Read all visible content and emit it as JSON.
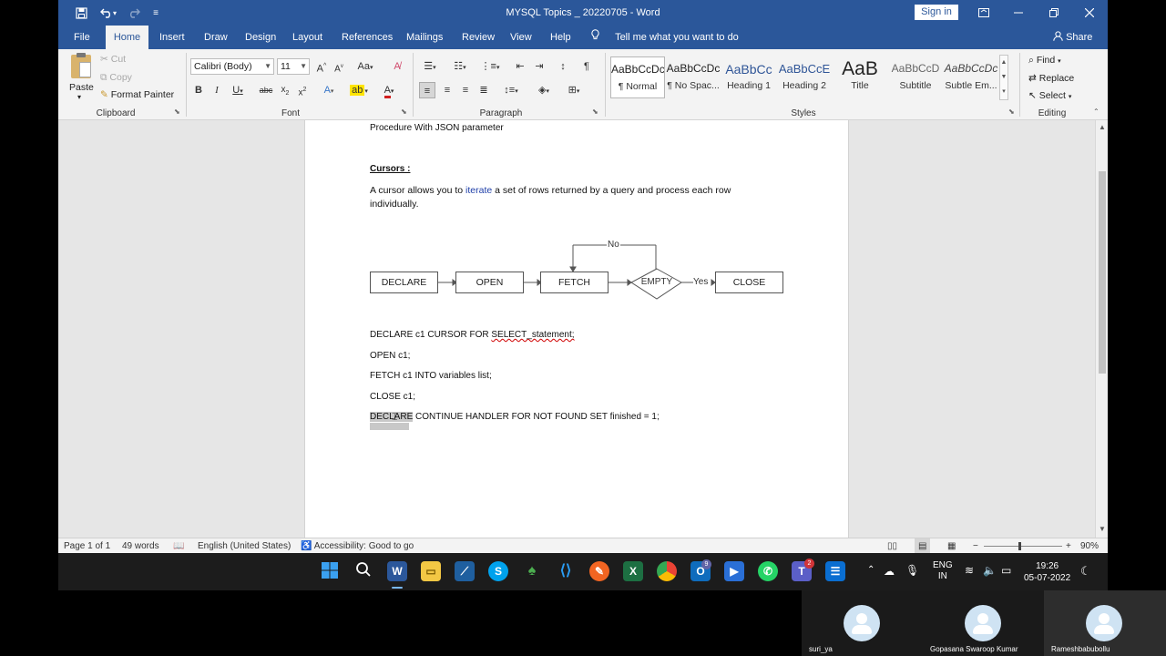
{
  "window": {
    "title": "MYSQL Topics  _  20220705  -  Word",
    "sign_in": "Sign in"
  },
  "tabs": [
    "File",
    "Home",
    "Insert",
    "Draw",
    "Design",
    "Layout",
    "References",
    "Mailings",
    "Review",
    "View",
    "Help"
  ],
  "active_tab": "Home",
  "tell_me": "Tell me what you want to do",
  "share": "Share",
  "clipboard": {
    "paste": "Paste",
    "cut": "Cut",
    "copy": "Copy",
    "format_painter": "Format Painter",
    "label": "Clipboard"
  },
  "font": {
    "name": "Calibri (Body)",
    "size": "11",
    "label": "Font"
  },
  "paragraph": {
    "label": "Paragraph"
  },
  "styles": {
    "label": "Styles",
    "items": [
      {
        "preview": "AaBbCcDc",
        "name": "¶ Normal"
      },
      {
        "preview": "AaBbCcDc",
        "name": "¶ No Spac..."
      },
      {
        "preview": "AaBbCc",
        "name": "Heading 1"
      },
      {
        "preview": "AaBbCcE",
        "name": "Heading 2"
      },
      {
        "preview": "AaB",
        "name": "Title"
      },
      {
        "preview": "AaBbCcD",
        "name": "Subtitle"
      },
      {
        "preview": "AaBbCcDc",
        "name": "Subtle Em..."
      }
    ]
  },
  "editing": {
    "find": "Find",
    "replace": "Replace",
    "select": "Select",
    "label": "Editing"
  },
  "document": {
    "line_procedure": "Procedure With JSON parameter",
    "cursors_heading": "Cursors :",
    "desc_part1": "A cursor allows you to ",
    "desc_link": "iterate",
    "desc_part2": " a set of rows returned by a query and process each row",
    "desc_line2": "individually.",
    "diagram": {
      "declare": "DECLARE",
      "open": "OPEN",
      "fetch": "FETCH",
      "empty": "EMPTY",
      "close": "CLOSE",
      "no": "No",
      "yes": "Yes"
    },
    "code_declare_a": "DECLARE c1 CURSOR FOR ",
    "code_declare_b": "SELECT_statement;",
    "code_open": "OPEN c1;",
    "code_fetch": "FETCH c1 INTO variables list;",
    "code_close": "CLOSE c1;",
    "code_handler_a": "DECLARE",
    "code_handler_b": " CONTINUE HANDLER FOR NOT FOUND SET finished = 1;"
  },
  "status": {
    "page": "Page 1 of 1",
    "words": "49 words",
    "language": "English (United States)",
    "accessibility": "Accessibility: Good to go",
    "zoom": "90%"
  },
  "taskbar": {
    "lang_top": "ENG",
    "lang_bottom": "IN",
    "time": "19:26",
    "date": "05-07-2022",
    "teams_badge": "2",
    "outlook_badge": "9"
  },
  "participants": [
    {
      "name": "suri_ya"
    },
    {
      "name": "Gopasana Swaroop Kumar"
    },
    {
      "name": "Rameshbabubollu"
    }
  ],
  "colors": {
    "word_blue": "#2b579a",
    "ribbon_bg": "#f3f3f3",
    "taskbar_bg": "#1c1c1c"
  }
}
